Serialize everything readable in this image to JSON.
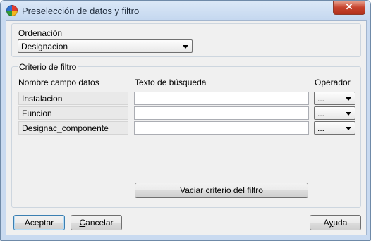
{
  "window": {
    "title": "Preselección de datos y filtro",
    "close_label": "✕"
  },
  "sort": {
    "label": "Ordenación",
    "selected": "Designacion"
  },
  "filter": {
    "group_label": "Criterio de filtro",
    "col_field": "Nombre campo datos",
    "col_search": "Texto de búsqueda",
    "col_operator": "Operador",
    "rows": [
      {
        "field": "Instalacion",
        "search": "",
        "operator": "..."
      },
      {
        "field": "Funcion",
        "search": "",
        "operator": "..."
      },
      {
        "field": "Designac_componente",
        "search": "",
        "operator": "..."
      }
    ],
    "clear_button": {
      "mnemonic": "V",
      "rest": "aciar criterio del filtro"
    }
  },
  "buttons": {
    "accept": "Aceptar",
    "cancel": {
      "mnemonic": "C",
      "rest": "ancelar"
    },
    "help": {
      "pre": "A",
      "mnemonic": "y",
      "rest": "uda"
    }
  }
}
